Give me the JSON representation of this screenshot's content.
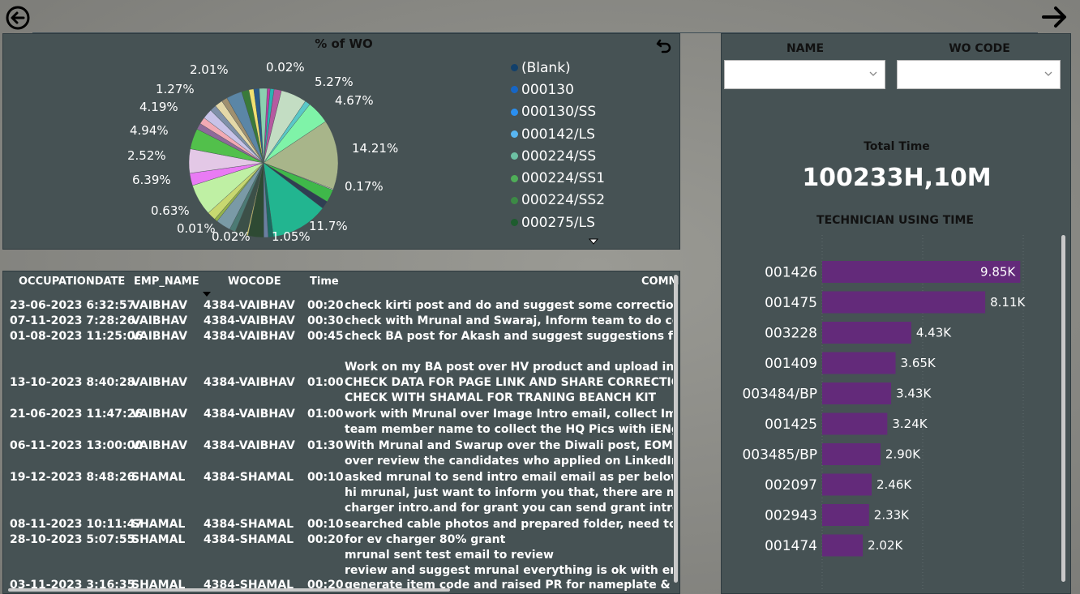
{
  "nav": {
    "back_icon": "arrow-left-circle-icon",
    "forward_icon": "arrow-right-icon"
  },
  "pie": {
    "title": "% of WO",
    "labels": [
      "0.02%",
      "5.27%",
      "4.67%",
      "14.21%",
      "0.17%",
      "11.7%",
      "1.05%",
      "0.02%",
      "0.01%",
      "0.63%",
      "6.39%",
      "2.52%",
      "4.94%",
      "4.19%",
      "1.27%",
      "2.01%"
    ],
    "legend": [
      {
        "label": "(Blank)",
        "color": "#12406b"
      },
      {
        "label": "000130",
        "color": "#1666c6"
      },
      {
        "label": "000130/SS",
        "color": "#2a8ff0"
      },
      {
        "label": "000142/LS",
        "color": "#58b6f2"
      },
      {
        "label": "000224/SS",
        "color": "#6dc0a3"
      },
      {
        "label": "000224/SS1",
        "color": "#4fae58"
      },
      {
        "label": "000224/SS2",
        "color": "#3c8a45"
      },
      {
        "label": "000275/LS",
        "color": "#1e5c2e"
      }
    ]
  },
  "table": {
    "headers": {
      "date": "OCCUPATIONDATE",
      "emp": "EMP_NAME",
      "wo": "WOCODE",
      "time": "Time",
      "comm": "COMM"
    },
    "rows": [
      {
        "date": "23-06-2023 6:32:57",
        "emp": "VAIBHAV",
        "wo": "4384-VAIBHAV",
        "time": "00:20",
        "comments": [
          "check kirti post and do and suggest some corrections for h"
        ]
      },
      {
        "date": "07-11-2023 7:28:26",
        "emp": "VAIBHAV",
        "wo": "4384-VAIBHAV",
        "time": "00:30",
        "comments": [
          "check with Mrunal and Swaraj, Inform team to do collectio"
        ]
      },
      {
        "date": "01-08-2023 11:25:06",
        "emp": "VAIBHAV",
        "wo": "4384-VAIBHAV",
        "time": "00:45",
        "comments": [
          "check BA post for Akash and suggest suggestions from my"
        ]
      },
      {
        "date": "13-10-2023 8:40:28",
        "emp": "VAIBHAV",
        "wo": "4384-VAIBHAV",
        "time": "01:00",
        "comments": [
          "Work on my BA post over HV product and upload in respec",
          "CHECK DATA FOR PAGE LINK AND SHARE CORRECTIONS N",
          "CHECK WITH SHAMAL FOR TRANING BEANCH KIT"
        ]
      },
      {
        "date": "21-06-2023 11:47:26",
        "emp": "VAIBHAV",
        "wo": "4384-VAIBHAV",
        "time": "01:00",
        "comments": [
          "work with Mrunal over Image Intro email, collect Images fr",
          "team member name to collect the HQ Pics with iENg Logo"
        ]
      },
      {
        "date": "06-11-2023 13:00:00",
        "emp": "VAIBHAV",
        "wo": "4384-VAIBHAV",
        "time": "01:30",
        "comments": [
          "With Mrunal and Swarup over the Diwali post, EOM post ar",
          "over review the candidates who applied on LinkedIn for the"
        ]
      },
      {
        "date": "19-12-2023 8:48:26",
        "emp": "SHAMAL",
        "wo": "4384-SHAMAL",
        "time": "00:10",
        "comments": [
          "asked mrunal to send intro email email as per below instar",
          "hi mrunal, just want to inform you that, there are many ele",
          "charger intro.and for grant you can send grant intro for NS"
        ]
      },
      {
        "date": "08-11-2023 10:11:47",
        "emp": "SHAMAL",
        "wo": "4384-SHAMAL",
        "time": "00:10",
        "comments": [
          "searched cable photos and prepared folder, need to share w"
        ]
      },
      {
        "date": "28-10-2023 5:07:55",
        "emp": "SHAMAL",
        "wo": "4384-SHAMAL",
        "time": "00:20",
        "comments": [
          "for ev charger 80% grant",
          "mrunal sent test email to review",
          "review and suggest mrunal everything is ok with email only"
        ]
      },
      {
        "date": "03-11-2023 3:16:35",
        "emp": "SHAMAL",
        "wo": "4384-SHAMAL",
        "time": "00:20",
        "comments": [
          "generate item code and raised PR for nameplate & pvc stic"
        ]
      }
    ]
  },
  "filters": {
    "name_label": "NAME",
    "wocode_label": "WO CODE",
    "name_value": "",
    "wocode_value": ""
  },
  "kpi": {
    "label": "Total Time",
    "value": "100233H,10M"
  },
  "chart_data": {
    "type": "bar",
    "title": "TECHNICIAN USING TIME",
    "categories": [
      "001426",
      "001475",
      "003228",
      "001409",
      "003484/BP",
      "001425",
      "003485/BP",
      "002097",
      "002943",
      "001474"
    ],
    "values": [
      9850,
      8110,
      4430,
      3650,
      3430,
      3240,
      2900,
      2460,
      2330,
      2020
    ],
    "value_labels": [
      "9.85K",
      "8.11K",
      "4.43K",
      "3.65K",
      "3.43K",
      "3.24K",
      "2.90K",
      "2.46K",
      "2.33K",
      "2.02K"
    ],
    "xlim": [
      0,
      10000
    ],
    "bar_color": "#632a7a"
  }
}
